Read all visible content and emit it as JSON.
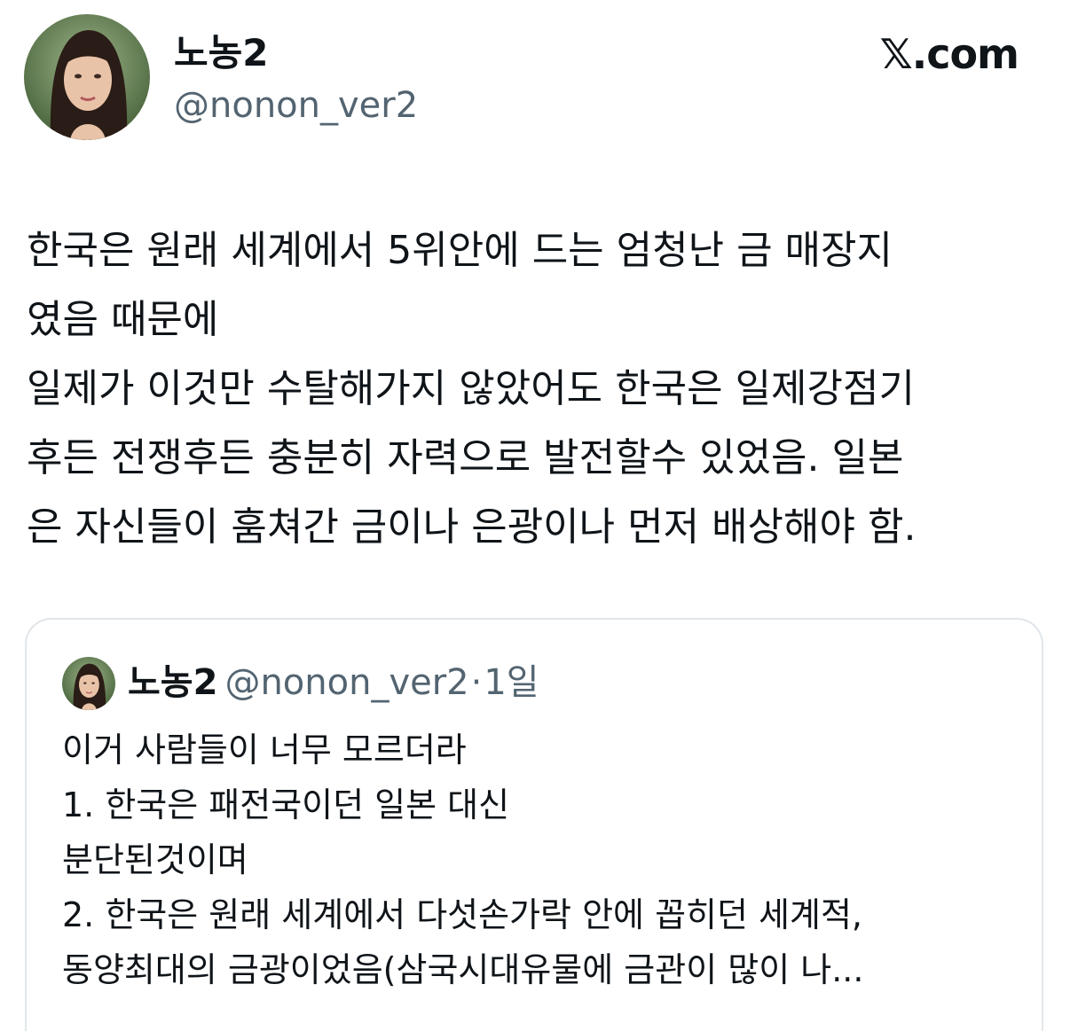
{
  "author": {
    "display_name": "노농2",
    "handle": "@nonon_ver2",
    "avatar": "profile-photo"
  },
  "brand": {
    "label": "𝕏.com"
  },
  "tweet": {
    "lines": [
      "한국은 원래 세계에서 5위안에 드는 엄청난 금 매장지",
      "였음 때문에",
      "일제가 이것만 수탈해가지 않았어도 한국은 일제강점기",
      "후든 전쟁후든 충분히 자력으로 발전할수 있었음. 일본",
      "은 자신들이 훔쳐간 금이나 은광이나 먼저 배상해야 함."
    ]
  },
  "quoted_tweet": {
    "display_name": "노농2",
    "handle": "@nonon_ver2",
    "separator": "·",
    "time": "1일",
    "lines": [
      "이거 사람들이 너무 모르더라",
      "1. 한국은 패전국이던 일본 대신",
      "분단된것이며",
      "2. 한국은 원래 세계에서 다섯손가락 안에 꼽히던 세계적,",
      "동양최대의 금광이었음(삼국시대유물에 금관이 많이 나..."
    ]
  },
  "colors": {
    "text_primary": "#0f1419",
    "text_secondary": "#536471",
    "card_border": "#e1e6ea"
  }
}
